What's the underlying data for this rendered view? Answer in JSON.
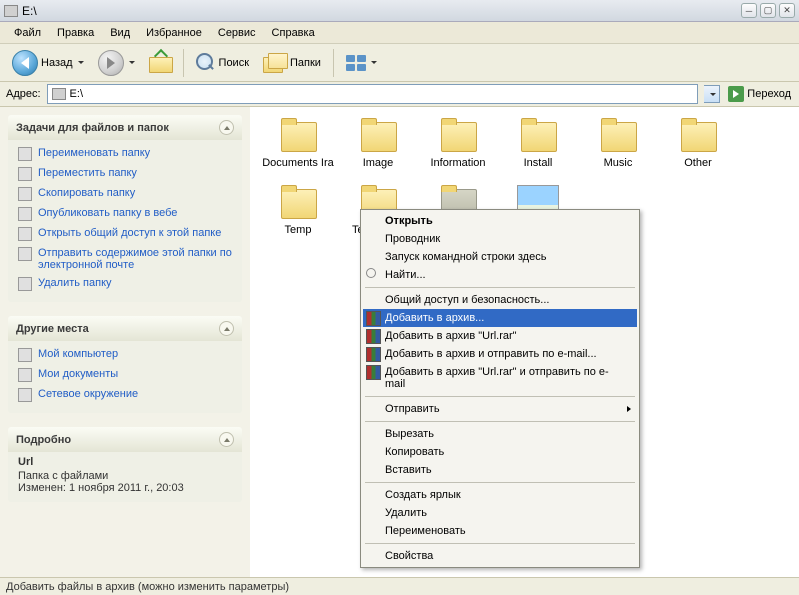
{
  "title": "E:\\",
  "address_label": "Адрес:",
  "address_value": "E:\\",
  "go_label": "Переход",
  "menubar": [
    "Файл",
    "Правка",
    "Вид",
    "Избранное",
    "Сервис",
    "Справка"
  ],
  "toolbar": {
    "back": "Назад",
    "search": "Поиск",
    "folders": "Папки"
  },
  "sidebar": {
    "tasks": {
      "title": "Задачи для файлов и папок",
      "items": [
        "Переименовать папку",
        "Переместить папку",
        "Скопировать папку",
        "Опубликовать папку в вебе",
        "Открыть общий доступ к этой папке",
        "Отправить содержимое этой папки по электронной почте",
        "Удалить папку"
      ]
    },
    "places": {
      "title": "Другие места",
      "items": [
        "Мой компьютер",
        "Мои документы",
        "Сетевое окружение"
      ]
    },
    "details": {
      "title": "Подробно",
      "name": "Url",
      "type": "Папка с файлами",
      "modified": "Изменен: 1 ноября 2011 г., 20:03"
    }
  },
  "files": [
    {
      "name": "Documents Ira",
      "type": "folder"
    },
    {
      "name": "Image",
      "type": "folder"
    },
    {
      "name": "Information",
      "type": "folder"
    },
    {
      "name": "Install",
      "type": "folder"
    },
    {
      "name": "Music",
      "type": "folder"
    },
    {
      "name": "Other",
      "type": "folder"
    },
    {
      "name": "Temp",
      "type": "folder"
    },
    {
      "name": "Temporary",
      "type": "folder"
    },
    {
      "name": "",
      "type": "folder-open",
      "selected": true
    },
    {
      "name": "",
      "type": "image"
    }
  ],
  "context_menu": {
    "groups": [
      [
        {
          "label": "Открыть",
          "bold": true
        },
        {
          "label": "Проводник"
        },
        {
          "label": "Запуск командной строки здесь"
        },
        {
          "label": "Найти...",
          "icon": "search"
        }
      ],
      [
        {
          "label": "Общий доступ и безопасность..."
        },
        {
          "label": "Добавить в архив...",
          "icon": "rar",
          "highlighted": true
        },
        {
          "label": "Добавить в архив \"Url.rar\"",
          "icon": "rar"
        },
        {
          "label": "Добавить в архив и отправить по e-mail...",
          "icon": "rar"
        },
        {
          "label": "Добавить в архив \"Url.rar\" и отправить по e-mail",
          "icon": "rar"
        }
      ],
      [
        {
          "label": "Отправить",
          "submenu": true
        }
      ],
      [
        {
          "label": "Вырезать"
        },
        {
          "label": "Копировать"
        },
        {
          "label": "Вставить"
        }
      ],
      [
        {
          "label": "Создать ярлык"
        },
        {
          "label": "Удалить"
        },
        {
          "label": "Переименовать"
        }
      ],
      [
        {
          "label": "Свойства"
        }
      ]
    ]
  },
  "statusbar": "Добавить файлы в архив (можно изменить параметры)"
}
